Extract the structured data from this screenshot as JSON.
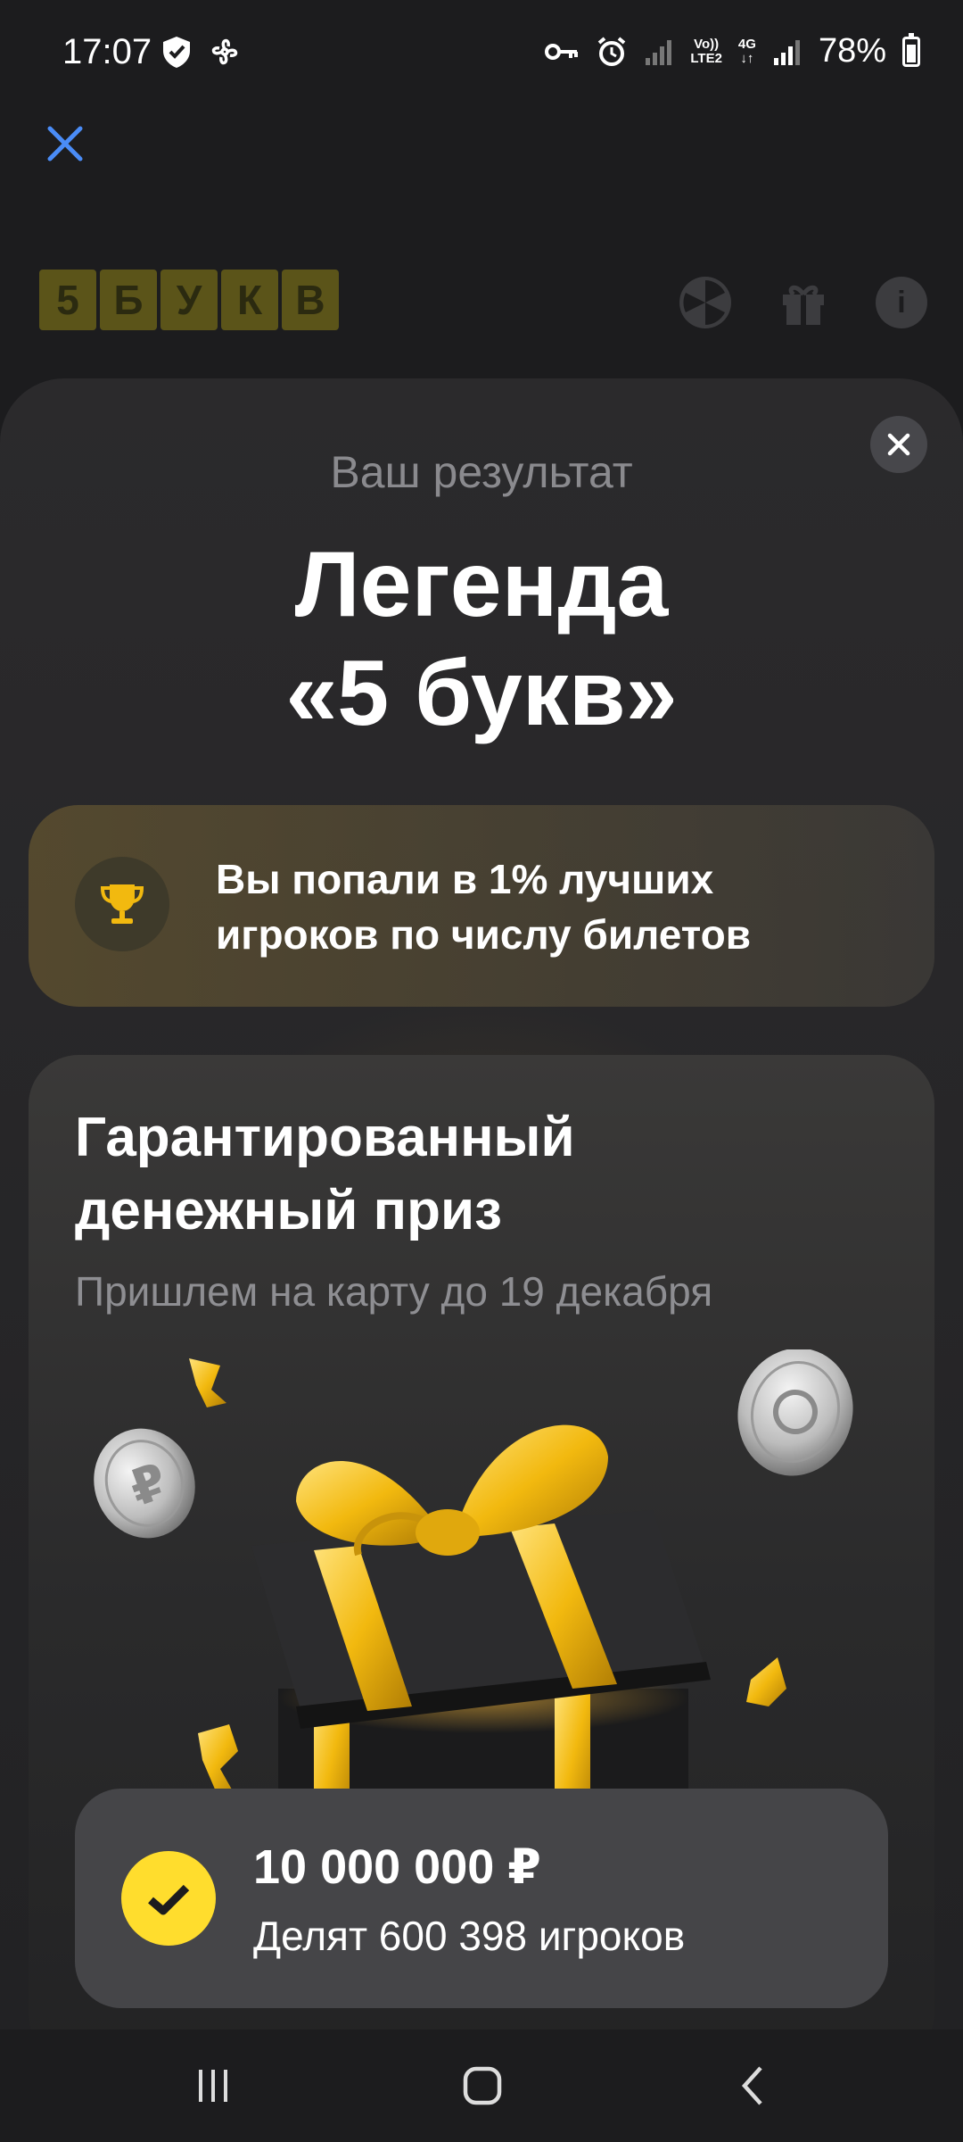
{
  "status_bar": {
    "time": "17:07",
    "network_label_top": "Vo))",
    "network_label_bottom": "LTE2",
    "network_4g": "4G",
    "battery": "78%"
  },
  "app": {
    "logo_letters": [
      "5",
      "Б",
      "У",
      "К",
      "В"
    ],
    "info_icon_glyph": "i"
  },
  "sheet": {
    "result_label": "Ваш результат",
    "title_line1": "Легенда",
    "title_line2": "«5 букв»",
    "rank_line1": "Вы попали в 1% лучших",
    "rank_line2": "игроков по числу билетов",
    "prize_title_line1": "Гарантированный",
    "prize_title_line2": "денежный приз",
    "prize_subtitle": "Пришлем на карту до 19 декабря",
    "amount": "10 000 000 ₽",
    "players": "Делят 600 398 игроков"
  },
  "colors": {
    "accent_yellow": "#ffdd2d",
    "gold": "#f2b90f",
    "close_blue": "#4a8cf7"
  }
}
